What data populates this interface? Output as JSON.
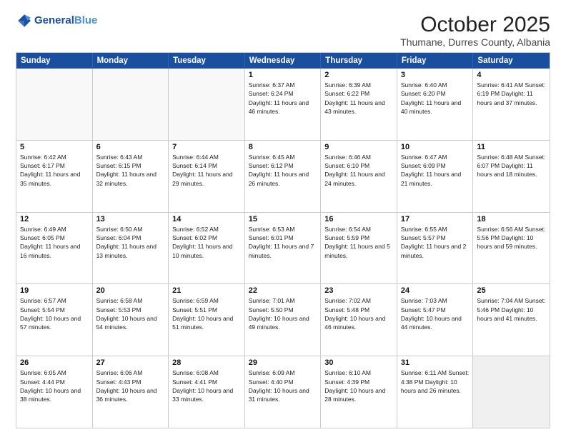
{
  "header": {
    "logo_line1": "General",
    "logo_line2": "Blue",
    "month": "October 2025",
    "location": "Thumane, Durres County, Albania"
  },
  "weekdays": [
    "Sunday",
    "Monday",
    "Tuesday",
    "Wednesday",
    "Thursday",
    "Friday",
    "Saturday"
  ],
  "rows": [
    [
      {
        "day": "",
        "info": "",
        "empty": true
      },
      {
        "day": "",
        "info": "",
        "empty": true
      },
      {
        "day": "",
        "info": "",
        "empty": true
      },
      {
        "day": "1",
        "info": "Sunrise: 6:37 AM\nSunset: 6:24 PM\nDaylight: 11 hours\nand 46 minutes."
      },
      {
        "day": "2",
        "info": "Sunrise: 6:39 AM\nSunset: 6:22 PM\nDaylight: 11 hours\nand 43 minutes."
      },
      {
        "day": "3",
        "info": "Sunrise: 6:40 AM\nSunset: 6:20 PM\nDaylight: 11 hours\nand 40 minutes."
      },
      {
        "day": "4",
        "info": "Sunrise: 6:41 AM\nSunset: 6:19 PM\nDaylight: 11 hours\nand 37 minutes."
      }
    ],
    [
      {
        "day": "5",
        "info": "Sunrise: 6:42 AM\nSunset: 6:17 PM\nDaylight: 11 hours\nand 35 minutes."
      },
      {
        "day": "6",
        "info": "Sunrise: 6:43 AM\nSunset: 6:15 PM\nDaylight: 11 hours\nand 32 minutes."
      },
      {
        "day": "7",
        "info": "Sunrise: 6:44 AM\nSunset: 6:14 PM\nDaylight: 11 hours\nand 29 minutes."
      },
      {
        "day": "8",
        "info": "Sunrise: 6:45 AM\nSunset: 6:12 PM\nDaylight: 11 hours\nand 26 minutes."
      },
      {
        "day": "9",
        "info": "Sunrise: 6:46 AM\nSunset: 6:10 PM\nDaylight: 11 hours\nand 24 minutes."
      },
      {
        "day": "10",
        "info": "Sunrise: 6:47 AM\nSunset: 6:09 PM\nDaylight: 11 hours\nand 21 minutes."
      },
      {
        "day": "11",
        "info": "Sunrise: 6:48 AM\nSunset: 6:07 PM\nDaylight: 11 hours\nand 18 minutes."
      }
    ],
    [
      {
        "day": "12",
        "info": "Sunrise: 6:49 AM\nSunset: 6:05 PM\nDaylight: 11 hours\nand 16 minutes."
      },
      {
        "day": "13",
        "info": "Sunrise: 6:50 AM\nSunset: 6:04 PM\nDaylight: 11 hours\nand 13 minutes."
      },
      {
        "day": "14",
        "info": "Sunrise: 6:52 AM\nSunset: 6:02 PM\nDaylight: 11 hours\nand 10 minutes."
      },
      {
        "day": "15",
        "info": "Sunrise: 6:53 AM\nSunset: 6:01 PM\nDaylight: 11 hours\nand 7 minutes."
      },
      {
        "day": "16",
        "info": "Sunrise: 6:54 AM\nSunset: 5:59 PM\nDaylight: 11 hours\nand 5 minutes."
      },
      {
        "day": "17",
        "info": "Sunrise: 6:55 AM\nSunset: 5:57 PM\nDaylight: 11 hours\nand 2 minutes."
      },
      {
        "day": "18",
        "info": "Sunrise: 6:56 AM\nSunset: 5:56 PM\nDaylight: 10 hours\nand 59 minutes."
      }
    ],
    [
      {
        "day": "19",
        "info": "Sunrise: 6:57 AM\nSunset: 5:54 PM\nDaylight: 10 hours\nand 57 minutes."
      },
      {
        "day": "20",
        "info": "Sunrise: 6:58 AM\nSunset: 5:53 PM\nDaylight: 10 hours\nand 54 minutes."
      },
      {
        "day": "21",
        "info": "Sunrise: 6:59 AM\nSunset: 5:51 PM\nDaylight: 10 hours\nand 51 minutes."
      },
      {
        "day": "22",
        "info": "Sunrise: 7:01 AM\nSunset: 5:50 PM\nDaylight: 10 hours\nand 49 minutes."
      },
      {
        "day": "23",
        "info": "Sunrise: 7:02 AM\nSunset: 5:48 PM\nDaylight: 10 hours\nand 46 minutes."
      },
      {
        "day": "24",
        "info": "Sunrise: 7:03 AM\nSunset: 5:47 PM\nDaylight: 10 hours\nand 44 minutes."
      },
      {
        "day": "25",
        "info": "Sunrise: 7:04 AM\nSunset: 5:46 PM\nDaylight: 10 hours\nand 41 minutes."
      }
    ],
    [
      {
        "day": "26",
        "info": "Sunrise: 6:05 AM\nSunset: 4:44 PM\nDaylight: 10 hours\nand 38 minutes."
      },
      {
        "day": "27",
        "info": "Sunrise: 6:06 AM\nSunset: 4:43 PM\nDaylight: 10 hours\nand 36 minutes."
      },
      {
        "day": "28",
        "info": "Sunrise: 6:08 AM\nSunset: 4:41 PM\nDaylight: 10 hours\nand 33 minutes."
      },
      {
        "day": "29",
        "info": "Sunrise: 6:09 AM\nSunset: 4:40 PM\nDaylight: 10 hours\nand 31 minutes."
      },
      {
        "day": "30",
        "info": "Sunrise: 6:10 AM\nSunset: 4:39 PM\nDaylight: 10 hours\nand 28 minutes."
      },
      {
        "day": "31",
        "info": "Sunrise: 6:11 AM\nSunset: 4:38 PM\nDaylight: 10 hours\nand 26 minutes."
      },
      {
        "day": "",
        "info": "",
        "empty": true,
        "shaded": true
      }
    ]
  ]
}
